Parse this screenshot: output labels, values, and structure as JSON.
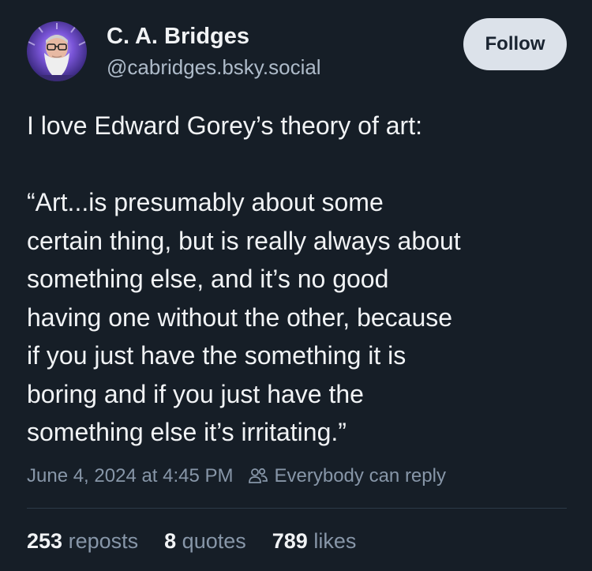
{
  "author": {
    "name": "C. A. Bridges",
    "handle": "@cabridges.bsky.social",
    "avatar_icon": "user-avatar"
  },
  "follow_label": "Follow",
  "post": {
    "lines": [
      "I love Edward Gorey’s theory of art:",
      "",
      "“Art...is presumably about some",
      "certain thing, but is really always about",
      "something else, and it’s no good",
      "having one without the other, because",
      "if you just have the something it is",
      "boring and if you just have the",
      "something else it’s irritating.”"
    ]
  },
  "meta": {
    "timestamp": "June 4, 2024 at 4:45 PM",
    "reply_icon": "people-icon",
    "reply_setting": "Everybody can reply"
  },
  "stats": {
    "reposts_count": "253",
    "reposts_label": "reposts",
    "quotes_count": "8",
    "quotes_label": "quotes",
    "likes_count": "789",
    "likes_label": "likes"
  },
  "colors": {
    "background": "#161e27",
    "text": "#f1f3f5",
    "muted": "#8796a8",
    "follow_bg": "#dce2ea"
  }
}
